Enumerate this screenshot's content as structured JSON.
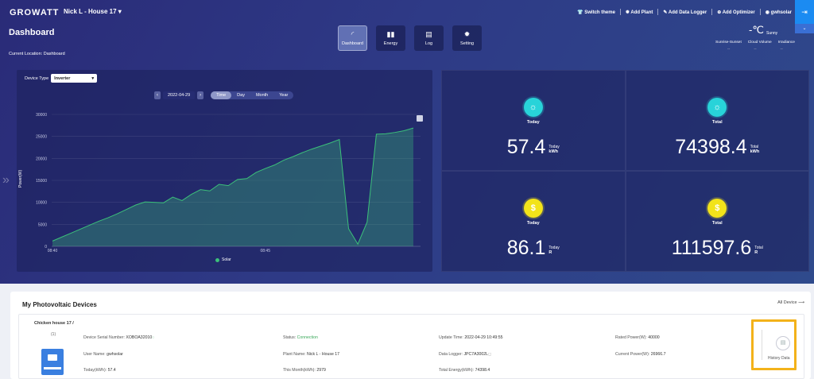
{
  "nav": {
    "logo": "GROWATT",
    "plant": "Nick L - House 17",
    "links": [
      "Switch theme",
      "Add Plant",
      "Add Data Logger",
      "Add Optimizer",
      "gwhsolar"
    ]
  },
  "header": {
    "title": "Dashboard",
    "location": "Current Location: Dashboard",
    "tabs": [
      {
        "label": "Dashboard",
        "icon": "gauge-icon",
        "glyph": "◜",
        "active": true
      },
      {
        "label": "Energy",
        "icon": "bar-chart-icon",
        "glyph": "▮▮",
        "active": false
      },
      {
        "label": "Log",
        "icon": "log-icon",
        "glyph": "▤",
        "active": false
      },
      {
        "label": "Setting",
        "icon": "gear-icon",
        "glyph": "✹",
        "active": false
      }
    ],
    "weather": {
      "temp": "-℃",
      "cond": "Sunny",
      "labels": [
        "Sunrise-Sunset",
        "Cloud Volume",
        "Irradiance"
      ],
      "values": [
        "--",
        "--",
        "--"
      ]
    }
  },
  "controls": {
    "device_type_label": "Device Type",
    "device_type": "Inverter",
    "date": "2022-04-29",
    "periods": [
      "Time",
      "Day",
      "Month",
      "Year"
    ],
    "active_period": "Time"
  },
  "chart_data": {
    "type": "area",
    "ylabel": "Power(W)",
    "ylim": [
      0,
      30000
    ],
    "yticks": [
      0,
      5000,
      10000,
      15000,
      20000,
      25000,
      30000
    ],
    "xtick_labels": [
      "08:40",
      "08:45"
    ],
    "legend": [
      "Solar"
    ],
    "series": [
      {
        "name": "Solar",
        "color": "#3cc07a",
        "values": [
          1200,
          2100,
          3000,
          3900,
          4800,
          5700,
          6500,
          7400,
          8400,
          9400,
          10100,
          10000,
          9900,
          11200,
          10400,
          11800,
          12900,
          12600,
          14100,
          13800,
          15200,
          15400,
          16800,
          17700,
          18500,
          19600,
          20400,
          21300,
          22100,
          22800,
          23500,
          24300,
          4000,
          500,
          5500,
          25500,
          25600,
          25900,
          26300,
          26900
        ],
        "anchors": {
          "dip_index": 33,
          "recover_index": 35
        }
      }
    ]
  },
  "stats": [
    {
      "icon": "sun-icon",
      "label": "Today",
      "value": "57.4",
      "unit_top": "Today",
      "unit": "kWh"
    },
    {
      "icon": "sun-icon",
      "label": "Total",
      "value": "74398.4",
      "unit_top": "Total",
      "unit": "kWh"
    },
    {
      "icon": "coin-icon",
      "label": "Today",
      "value": "86.1",
      "unit_top": "Today",
      "unit": "R"
    },
    {
      "icon": "coin-icon",
      "label": "Total",
      "value": "111597.6",
      "unit_top": "Total",
      "unit": "R"
    }
  ],
  "devices": {
    "title": "My Photovoltaic Devices",
    "all_link": "All Device",
    "card": {
      "name": "Chicken house 17 /",
      "index": "(1)",
      "fields": [
        {
          "label": "Device Serial Number:",
          "value": "XOBOA32010"
        },
        {
          "label": "Status:",
          "value": "Connection"
        },
        {
          "label": "Update Time:",
          "value": "2022-04-29 10:49:55"
        },
        {
          "label": "Rated Power(W):",
          "value": "40000"
        },
        {
          "label": "User Name:",
          "value": "gwhsolar"
        },
        {
          "label": "Plant Name:",
          "value": "Nick L - House 17"
        },
        {
          "label": "Data Logger:",
          "value": "JPC7A3002L"
        },
        {
          "label": "Current Power(W):",
          "value": "26966.7"
        },
        {
          "label": "Today(kWh):",
          "value": "57.4"
        },
        {
          "label": "This Month(kWh):",
          "value": "2979"
        },
        {
          "label": "Total Energy(kWh):",
          "value": "74398.4"
        }
      ],
      "history": "History Data"
    }
  }
}
